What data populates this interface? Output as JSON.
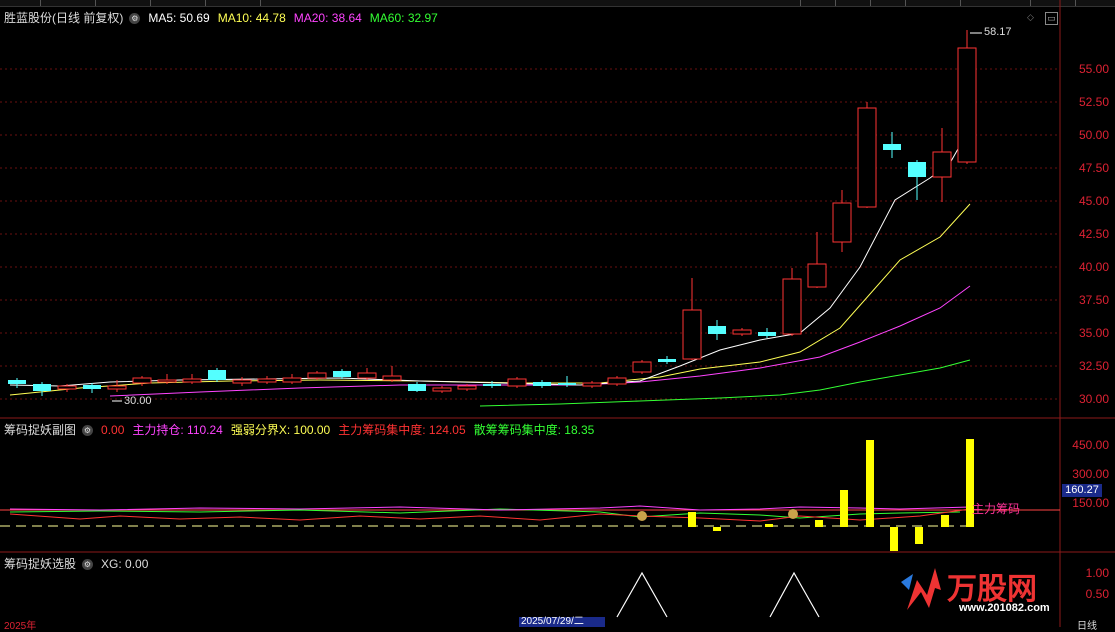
{
  "header": {
    "stock_title": "胜蓝股份(日线 前复权)",
    "ma5": "MA5: 50.69",
    "ma10": "MA10: 44.78",
    "ma20": "MA20: 38.64",
    "ma60": "MA60: 32.97",
    "high_label": "58.17",
    "low_label": "30.00"
  },
  "price_axis": [
    "55.00",
    "52.50",
    "50.00",
    "47.50",
    "45.00",
    "42.50",
    "40.00",
    "37.50",
    "35.00",
    "32.50",
    "30.00"
  ],
  "sub_panel": {
    "title": "筹码捉妖副图",
    "v0": "0.00",
    "main_pos": "主力持仓: 110.24",
    "strong_weak": "强弱分界X: 100.00",
    "main_conc": "主力筹码集中度: 124.05",
    "retail_conc": "散筹筹码集中度: 18.35",
    "axis": [
      "450.00",
      "300.00",
      "150.00"
    ],
    "current_value": "160.27",
    "annotation": "主力筹码"
  },
  "select_panel": {
    "title": "筹码捉妖选股",
    "xg": "XG: 0.00",
    "axis": [
      "1.00",
      "0.50"
    ]
  },
  "footer": {
    "year": "2025年",
    "selected_date": "2025/07/29/二",
    "period": "日线"
  },
  "watermark": {
    "brand": "万股网",
    "url": "www.201082.com"
  },
  "colors": {
    "up": "#ff3333",
    "down": "#54ffff",
    "ma5": "#ffffff",
    "ma10": "#ffff55",
    "ma20": "#ff44ff",
    "ma60": "#33ff33"
  }
}
